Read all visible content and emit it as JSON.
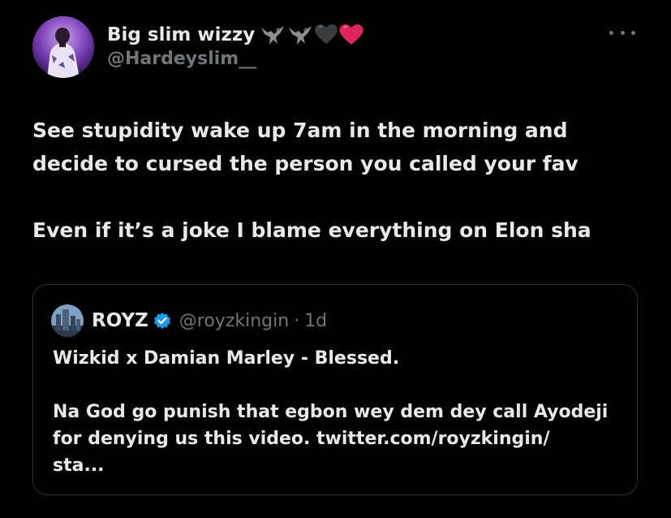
{
  "tweet": {
    "display_name": "Big slim wizzy",
    "emojis": [
      "eagle-icon",
      "eagle-icon",
      "black-heart-icon",
      "red-heart-icon"
    ],
    "handle": "@Hardeyslim__",
    "text_lines": [
      "See stupidity wake up 7am in the morning and",
      "decide to cursed the person you called your fav",
      "Even if it’s a joke I blame everything on Elon sha"
    ]
  },
  "quote": {
    "name": "ROYZ",
    "handle": "@royzkingin",
    "separator": "·",
    "time": "1d",
    "lines": [
      "Wizkid x Damian Marley - Blessed.",
      "Na God go punish that egbon wey dem dey call Ayodeji",
      "for denying us this video. twitter.com/royzkingin/",
      "sta..."
    ]
  },
  "colors": {
    "background": "#000000",
    "text": "#e7e9ea",
    "secondary_text": "#71767b",
    "border": "#2f3336",
    "verified": "#1d9bf0",
    "red_heart": "#e0245e"
  }
}
